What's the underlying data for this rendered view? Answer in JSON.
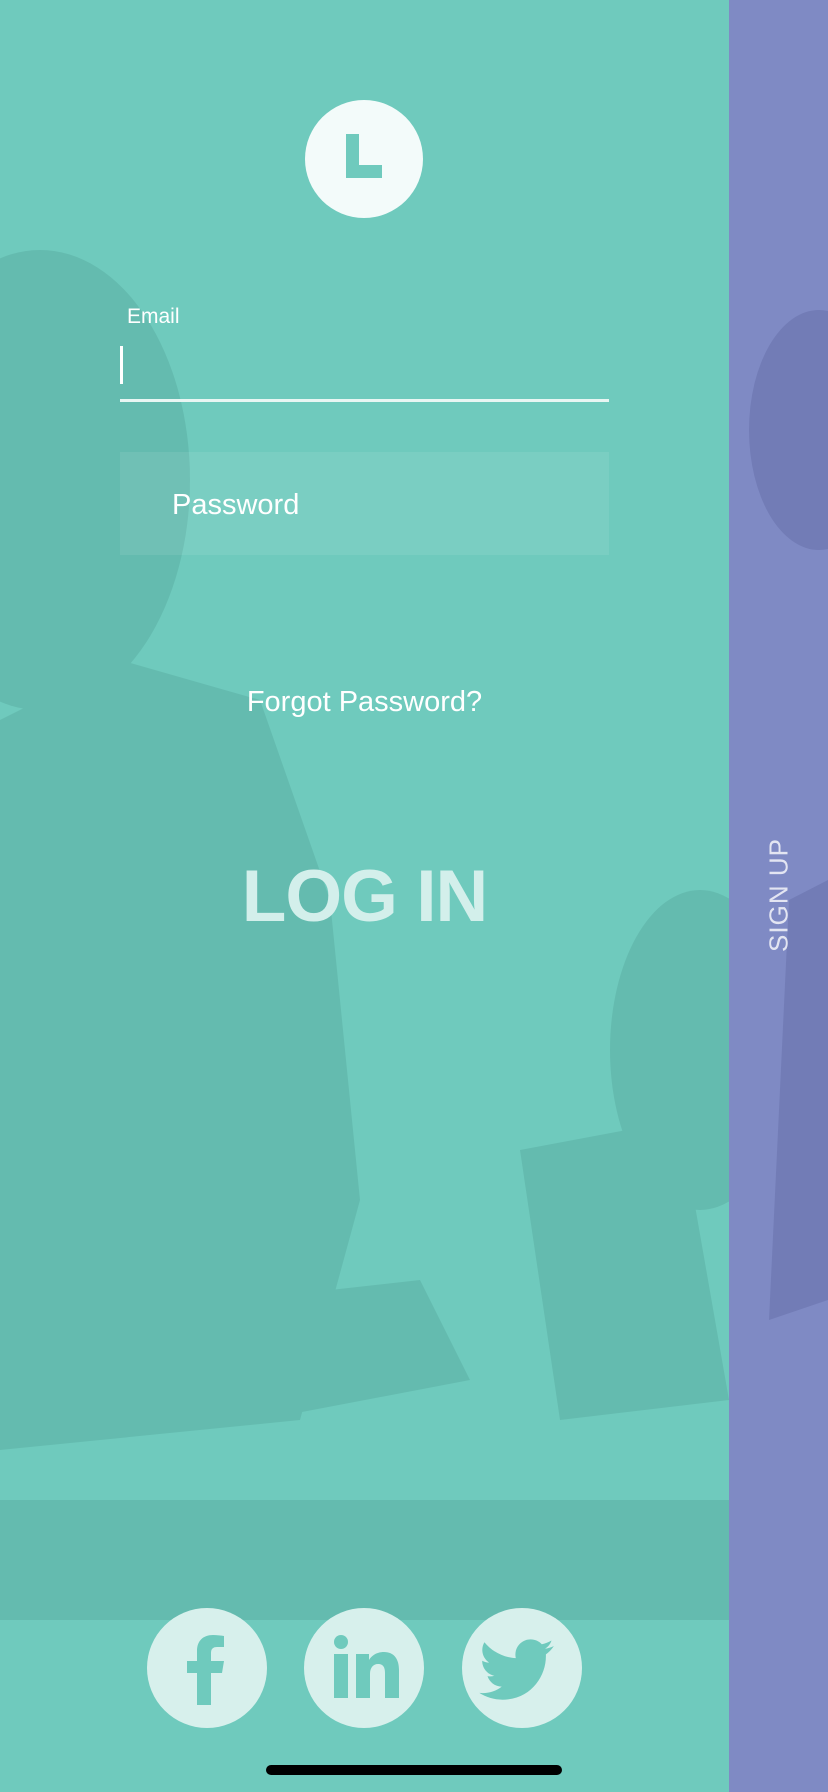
{
  "login": {
    "logo_letter": "L",
    "email_label": "Email",
    "email_value": "",
    "password_placeholder": "Password",
    "forgot_password": "Forgot Password?",
    "login_button": "LOG IN"
  },
  "signup": {
    "label": "SIGN UP"
  },
  "social": [
    {
      "name": "facebook",
      "icon": "facebook-icon"
    },
    {
      "name": "linkedin",
      "icon": "linkedin-icon"
    },
    {
      "name": "twitter",
      "icon": "twitter-icon"
    }
  ],
  "colors": {
    "login_panel": "#6fcabd",
    "signup_panel": "#7f8ac4",
    "social_circle": "#d7f0ec",
    "login_button_text": "#d3efeb"
  }
}
